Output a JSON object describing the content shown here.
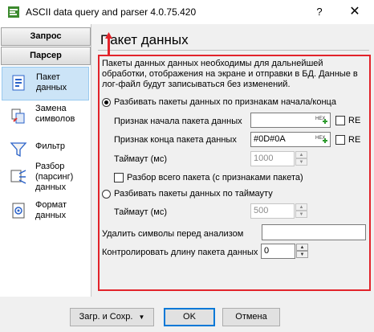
{
  "window": {
    "title": "ASCII data query and parser 4.0.75.420",
    "help_glyph": "?",
    "close_glyph": "✕",
    "app_icon": "ascii-parser-app-icon"
  },
  "sidebar": {
    "tabs": [
      {
        "label": "Запрос"
      },
      {
        "label": "Парсер"
      }
    ],
    "items": [
      {
        "line1": "Пакет",
        "line2": "данных",
        "line3": "",
        "icon": "data-packet-icon",
        "active": true
      },
      {
        "line1": "Замена",
        "line2": "символов",
        "line3": "",
        "icon": "symbol-replace-icon",
        "active": false
      },
      {
        "line1": "Фильтр",
        "line2": "",
        "line3": "",
        "icon": "filter-icon",
        "active": false
      },
      {
        "line1": "Разбор",
        "line2": "(парсинг)",
        "line3": "данных",
        "icon": "parsing-icon",
        "active": false
      },
      {
        "line1": "Формат",
        "line2": "данных",
        "line3": "",
        "icon": "data-format-icon",
        "active": false
      }
    ]
  },
  "main": {
    "heading": "Пакет данных",
    "annotation_number": "1",
    "annotation_color": "#e2232a",
    "description": "Пакеты данных данных необходимы для дальнейшей обработки, отображения на экране и отправки в БД. Данные в лог-файл будут записываться без изменений.",
    "mode_markers": {
      "label": "Разбивать пакеты данных по признакам начала/конца",
      "selected": true,
      "start_label": "Признак начала пакета данных",
      "start_value": "",
      "end_label": "Признак конца пакета данных",
      "end_value": "#0D#0A",
      "re_label": "RE",
      "timeout_label": "Таймаут (мс)",
      "timeout_value": "1000",
      "parse_whole_label": "Разбор всего пакета (с признаками пакета)"
    },
    "mode_timeout": {
      "label": "Разбивать пакеты данных по таймауту",
      "selected": false,
      "timeout_label": "Таймаут (мс)",
      "timeout_value": "500"
    },
    "remove_chars_label": "Удалить символы перед анализом",
    "remove_chars_value": "",
    "control_length_label": "Контролировать длину пакета данных",
    "control_length_value": "0",
    "hex_button_text": "HEX"
  },
  "footer": {
    "load_save_label": "Загр. и Сохр.",
    "ok_label": "OK",
    "cancel_label": "Отмена"
  }
}
